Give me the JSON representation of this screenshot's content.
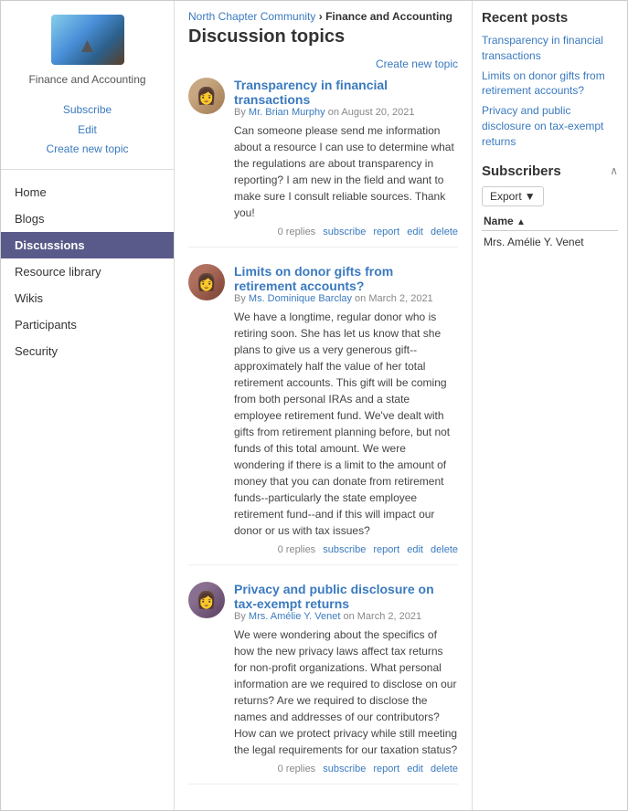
{
  "breadcrumb": {
    "community": "North Chapter Community",
    "separator": " › ",
    "current": "Finance and Accounting"
  },
  "page_title": "Discussion topics",
  "create_link": "Create new topic",
  "sidebar": {
    "logo_title": "Finance and Accounting",
    "links": [
      "Subscribe",
      "Edit",
      "Create new topic"
    ],
    "nav_items": [
      "Home",
      "Blogs",
      "Discussions",
      "Resource library",
      "Wikis",
      "Participants",
      "Security"
    ]
  },
  "posts": [
    {
      "title": "Transparency in financial transactions",
      "author": "Mr. Brian Murphy",
      "date": "August 20, 2021",
      "text": "Can someone please send me information about a resource I can use to determine what the regulations are about transparency in reporting? I am new in the field and want to make sure I consult reliable sources. Thank you!",
      "actions": [
        "0 replies",
        "subscribe",
        "report",
        "edit",
        "delete"
      ],
      "avatar_class": "avatar-1",
      "avatar_emoji": "👩"
    },
    {
      "title": "Limits on donor gifts from retirement accounts?",
      "author": "Ms. Dominique Barclay",
      "date": "March 2, 2021",
      "text": "We have a longtime, regular donor who is retiring soon. She has let us know that she plans to give us a very generous gift--approximately half the value of her total retirement accounts. This gift will be coming from both personal IRAs and a state employee retirement fund. We've dealt with gifts from retirement planning before, but not funds of this total amount. We were wondering if there is a limit to the amount of money that you can donate from retirement funds--particularly the state employee retirement fund--and if this will impact our donor or us with tax issues?",
      "actions": [
        "0 replies",
        "subscribe",
        "report",
        "edit",
        "delete"
      ],
      "avatar_class": "avatar-2",
      "avatar_emoji": "👩"
    },
    {
      "title": "Privacy and public disclosure on tax-exempt returns",
      "author": "Mrs. Amélie Y. Venet",
      "date": "March 2, 2021",
      "text": "We were wondering about the specifics of how the new privacy laws affect tax returns for non-profit organizations. What personal information are we required to disclose on our returns? Are we required to disclose the names and addresses of our contributors? How can we protect privacy while still meeting the legal requirements for our taxation status?",
      "actions": [
        "0 replies",
        "subscribe",
        "report",
        "edit",
        "delete"
      ],
      "avatar_class": "avatar-3",
      "avatar_emoji": "👩"
    }
  ],
  "recent_posts": {
    "title": "Recent posts",
    "links": [
      "Transparency in financial transactions",
      "Limits on donor gifts from retirement accounts?",
      "Privacy and public disclosure on tax-exempt returns"
    ]
  },
  "subscribers": {
    "title": "Subscribers",
    "export_label": "Export",
    "export_arrow": "▼",
    "table_header": "Name",
    "sort_arrow": "▲",
    "rows": [
      "Mrs. Amélie Y. Venet"
    ]
  }
}
